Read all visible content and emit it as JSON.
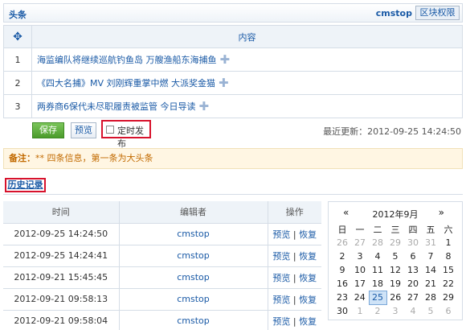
{
  "topbar": {
    "title": "头条",
    "user": "cmstop",
    "permission_button": "区块权限"
  },
  "content_table": {
    "header": "内容",
    "rows": [
      {
        "num": "1",
        "text": "海监编队将继续巡航钓鱼岛 万艘渔船东海捕鱼"
      },
      {
        "num": "2",
        "text": "《四大名捕》MV 刘刚辉重掌中燃 大派奖金猫"
      },
      {
        "num": "3",
        "text": "两券商6保代未尽职履责被监管  今日导读"
      }
    ]
  },
  "actions": {
    "save_label": "保存",
    "preview_label": "预览",
    "schedule_label": "定时发布",
    "last_update": "最近更新：2012-09-25 14:24:50"
  },
  "notice": {
    "prefix": "备注：",
    "text": "** 四条信息，第一条为大头条"
  },
  "history": {
    "title": "历史记录",
    "columns": [
      "时间",
      "编辑者",
      "操作"
    ],
    "rows": [
      {
        "time": "2012-09-25 14:24:50",
        "editor": "cmstop",
        "preview": "预览",
        "restore": "恢复"
      },
      {
        "time": "2012-09-25 14:24:41",
        "editor": "cmstop",
        "preview": "预览",
        "restore": "恢复"
      },
      {
        "time": "2012-09-21 15:45:45",
        "editor": "cmstop",
        "preview": "预览",
        "restore": "恢复"
      },
      {
        "time": "2012-09-21 09:58:13",
        "editor": "cmstop",
        "preview": "预览",
        "restore": "恢复"
      },
      {
        "time": "2012-09-21 09:58:04",
        "editor": "cmstop",
        "preview": "预览",
        "restore": "恢复"
      }
    ]
  },
  "calendar": {
    "prev": "«",
    "next": "»",
    "month_label": "2012年9月",
    "weekdays": [
      "日",
      "一",
      "二",
      "三",
      "四",
      "五",
      "六"
    ],
    "weeks": [
      [
        {
          "d": "26",
          "o": true
        },
        {
          "d": "27",
          "o": true
        },
        {
          "d": "28",
          "o": true
        },
        {
          "d": "29",
          "o": true
        },
        {
          "d": "30",
          "o": true
        },
        {
          "d": "31",
          "o": true
        },
        {
          "d": "1"
        }
      ],
      [
        {
          "d": "2"
        },
        {
          "d": "3"
        },
        {
          "d": "4"
        },
        {
          "d": "5"
        },
        {
          "d": "6"
        },
        {
          "d": "7"
        },
        {
          "d": "8"
        }
      ],
      [
        {
          "d": "9"
        },
        {
          "d": "10"
        },
        {
          "d": "11"
        },
        {
          "d": "12"
        },
        {
          "d": "13"
        },
        {
          "d": "14"
        },
        {
          "d": "15"
        }
      ],
      [
        {
          "d": "16"
        },
        {
          "d": "17"
        },
        {
          "d": "18"
        },
        {
          "d": "19"
        },
        {
          "d": "20"
        },
        {
          "d": "21"
        },
        {
          "d": "22"
        }
      ],
      [
        {
          "d": "23"
        },
        {
          "d": "24"
        },
        {
          "d": "25",
          "s": true
        },
        {
          "d": "26"
        },
        {
          "d": "27"
        },
        {
          "d": "28"
        },
        {
          "d": "29"
        }
      ],
      [
        {
          "d": "30"
        },
        {
          "d": "1",
          "o": true
        },
        {
          "d": "2",
          "o": true
        },
        {
          "d": "3",
          "o": true
        },
        {
          "d": "4",
          "o": true
        },
        {
          "d": "5",
          "o": true
        },
        {
          "d": "6",
          "o": true
        }
      ]
    ]
  },
  "colors": {
    "accent": "#1a5aa6",
    "save_green": "#4a9b2a",
    "highlight_red": "#d7122c",
    "notice_bg": "#fff6e3"
  }
}
